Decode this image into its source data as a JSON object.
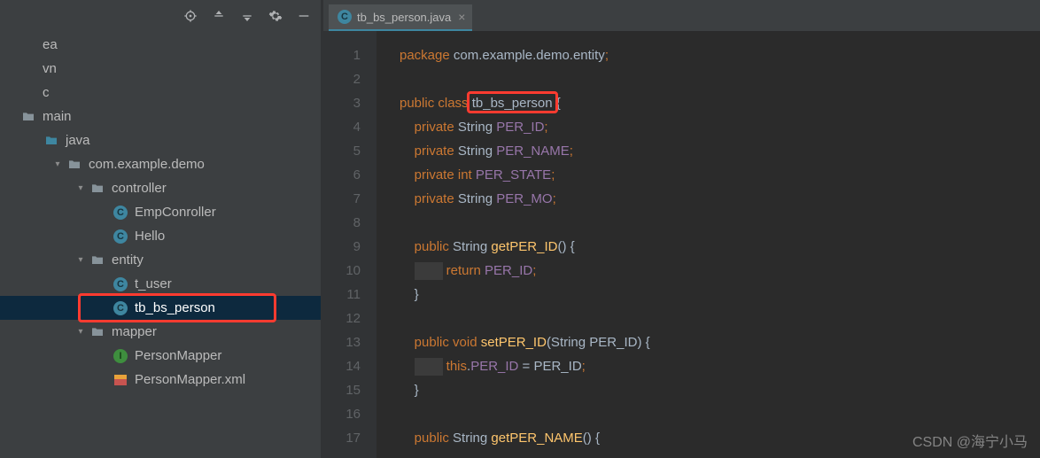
{
  "toolbar": {
    "icons": [
      "target",
      "expand",
      "collapse",
      "gear",
      "minimize"
    ]
  },
  "tree": {
    "nodes": [
      {
        "depth": 0,
        "arrow": "",
        "icon": "none",
        "label": "ea"
      },
      {
        "depth": 0,
        "arrow": "",
        "icon": "none",
        "label": "vn"
      },
      {
        "depth": 0,
        "arrow": "",
        "icon": "none",
        "label": "c"
      },
      {
        "depth": 0,
        "arrow": "",
        "icon": "folder",
        "label": "main"
      },
      {
        "depth": 1,
        "arrow": "",
        "icon": "folder-blue",
        "label": "java"
      },
      {
        "depth": 2,
        "arrow": "v",
        "icon": "folder",
        "label": "com.example.demo"
      },
      {
        "depth": 3,
        "arrow": "v",
        "icon": "folder",
        "label": "controller"
      },
      {
        "depth": 4,
        "arrow": "",
        "icon": "class",
        "label": "EmpConroller"
      },
      {
        "depth": 4,
        "arrow": "",
        "icon": "class",
        "label": "Hello"
      },
      {
        "depth": 3,
        "arrow": "v",
        "icon": "folder",
        "label": "entity"
      },
      {
        "depth": 4,
        "arrow": "",
        "icon": "class",
        "label": "t_user"
      },
      {
        "depth": 4,
        "arrow": "",
        "icon": "class",
        "label": "tb_bs_person",
        "selected": true,
        "boxed": true
      },
      {
        "depth": 3,
        "arrow": "v",
        "icon": "folder",
        "label": "mapper"
      },
      {
        "depth": 4,
        "arrow": "",
        "icon": "interface",
        "label": "PersonMapper"
      },
      {
        "depth": 4,
        "arrow": "",
        "icon": "xml",
        "label": "PersonMapper.xml"
      }
    ]
  },
  "tab": {
    "label": "tb_bs_person.java"
  },
  "code": {
    "package": "com.example.demo.entity",
    "className": "tb_bs_person",
    "lines": 17
  },
  "highlightClassName": "tb_bs_person",
  "watermark": "CSDN @海宁小马"
}
